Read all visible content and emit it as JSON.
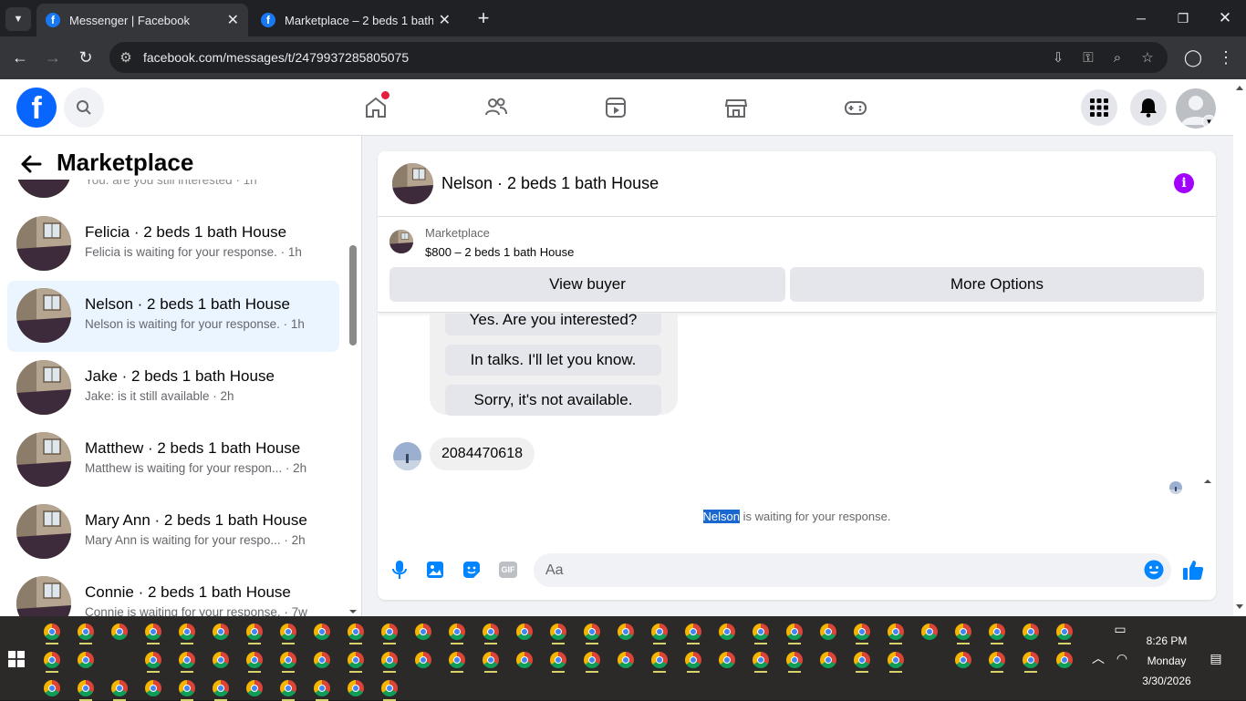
{
  "browser": {
    "tabs": [
      {
        "title": "Messenger | Facebook",
        "active": true
      },
      {
        "title": "Marketplace – 2 beds 1 bath House",
        "active": false
      }
    ],
    "url": "facebook.com/messages/t/2479937285805075"
  },
  "sidebar": {
    "title": "Marketplace",
    "partial_preview": "You: are you still interested · 1h",
    "conversations": [
      {
        "name": "Felicia · 2 beds 1 bath House",
        "preview": "Felicia is waiting for your response. · 1h",
        "selected": false
      },
      {
        "name": "Nelson · 2 beds 1 bath House",
        "preview": "Nelson is waiting for your response. · 1h",
        "selected": true
      },
      {
        "name": "Jake · 2 beds 1 bath House",
        "preview": "Jake: is it still available · 2h",
        "selected": false
      },
      {
        "name": "Matthew · 2 beds 1 bath House",
        "preview": "Matthew is waiting for your respon... · 2h",
        "selected": false
      },
      {
        "name": "Mary Ann · 2 beds 1 bath House",
        "preview": "Mary Ann is waiting for your respo... · 2h",
        "selected": false
      },
      {
        "name": "Connie · 2 beds 1 bath House",
        "preview": "Connie is waiting for your response. · 7w",
        "selected": false
      }
    ]
  },
  "chat": {
    "title": "Nelson · 2 beds 1 bath House",
    "marketplace_label": "Marketplace",
    "listing": "$800 – 2 beds 1 bath House",
    "view_buyer": "View buyer",
    "more_options": "More Options",
    "quick_replies": [
      "Yes. Are you interested?",
      "In talks. I'll let you know.",
      "Sorry, it's not available."
    ],
    "message": "2084470618",
    "waiting_name": "Nelson",
    "waiting_text": " is waiting for your response.",
    "input_placeholder": "Aa"
  },
  "taskbar": {
    "time": "8:26 PM",
    "day": "Monday",
    "date": "3/30/2026"
  },
  "colors": {
    "brand": "#0866ff",
    "accent": "#0084ff",
    "info": "#a200ff"
  }
}
